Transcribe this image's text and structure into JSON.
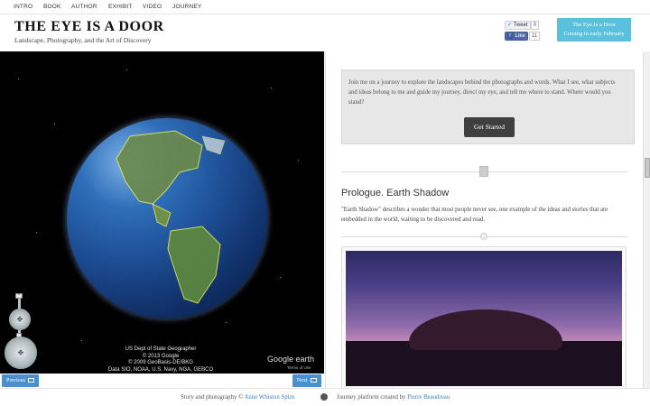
{
  "nav": {
    "items": [
      "INTRO",
      "BOOK",
      "AUTHOR",
      "EXHIBIT",
      "VIDEO",
      "JOURNEY"
    ]
  },
  "header": {
    "title": "THE EYE IS A DOOR",
    "tagline": "Landscape, Photography, and the Art of Discovery"
  },
  "social": {
    "tweet_label": "Tweet",
    "tweet_count": "0",
    "like_label": "Like",
    "like_count": "11"
  },
  "cta": {
    "line1": "The Eye Is a Door",
    "line2": "Coming in early February"
  },
  "map": {
    "attribution": [
      "US Dept of State Geographer",
      "© 2013 Google",
      "© 2009 GeoBasis-DE/BKG",
      "Data SIO, NOAA, U.S. Navy, NGA, GEBCO"
    ],
    "brand": "Google earth",
    "terms": "Terms of Use",
    "prev_label": "Previous",
    "next_label": "Next"
  },
  "intro": {
    "text": "Join me on a journey to explore the landscapes behind the photographs and words. What I see, what subjects and ideas belong to me and guide my journey, direct my eye, and tell me where to stand. Where would you stand?",
    "button": "Get Started"
  },
  "chapter": {
    "title": "Prologue. Earth Shadow",
    "description": "\"Earth Shadow\" describes a wonder that most people never see, one example of the ideas and stories that are embedded in the world, waiting to be discovered and read."
  },
  "footer": {
    "credit_prefix": "Story and photography ©",
    "author_link": "Anne Whiston Spirn",
    "platform_prefix": "Journey platform created by",
    "platform_link": "Pierre Beaudreau"
  },
  "colors": {
    "accent": "#5bc0de",
    "button_dark": "#3f3f3f",
    "link": "#3b83c5",
    "nav_button": "#4a8fd0"
  }
}
